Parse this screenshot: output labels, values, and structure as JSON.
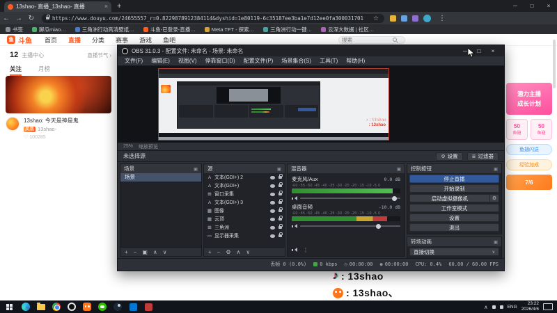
{
  "colors": {
    "douyu_orange": "#ff5d23",
    "obs_active_blue": "#31599b",
    "meter_green": "#3faa3f",
    "tiktok_cyan": "#25f4ee",
    "tiktok_red": "#fe2c55"
  },
  "icons": {
    "back": "←",
    "forward": "→",
    "refresh": "↻",
    "star": "☆",
    "more": "⋮",
    "min": "─",
    "max": "□",
    "close": "×",
    "newtab": "+",
    "plus": "+",
    "minus": "−",
    "up": "∧",
    "down": "∨",
    "gear": "⚙",
    "filter": "≣",
    "popout": "▣",
    "caret": "∨",
    "note": "♪",
    "clock": "◷",
    "rec": "●",
    "heart": "♡",
    "chev": "›",
    "tray_up": "∧"
  },
  "browser": {
    "tab_title": "13shao- 直播_13shao- 直播",
    "url": "https://www.douyu.com/24655557_r=0.8229878912384114&dyshid=1e80119-6c35187ee3ba1e7d12ee0fa300031701",
    "bookmarks": [
      "书签",
      "脚瓜miao…",
      "三角洲行动高清壁纸…",
      "斗鱼-已登录-直播…",
      "Meta TFT - 探索…",
      "三角洲行动一键…",
      "云深大数据 | 社区…"
    ]
  },
  "site": {
    "logo_glyph": "鱼",
    "logo_text": "斗鱼",
    "nav": [
      "首页",
      "直播",
      "分类",
      "赛事",
      "游戏",
      "鱼吧"
    ],
    "search_placeholder": "搜索",
    "sidebar": {
      "count": "12",
      "count_label": "主播中心",
      "more_link": "直播节气 ›",
      "tabs": [
        "关注",
        "月榜"
      ],
      "card": {
        "title": "13shao: 今天是神是鬼",
        "badge": "凤凰",
        "name": "13shao-",
        "viewers": "100285"
      }
    },
    "rail": {
      "banner_line1": "潜力主播",
      "banner_line2": "成长计划",
      "chip1_num": "50",
      "chip1_label": "鱼翅",
      "chip2_num": "50",
      "chip2_label": "鱼翅",
      "chip3": "鱼翅闪送",
      "chip4": "经验加成",
      "mini": "7/6"
    }
  },
  "overlay": {
    "line1": ": 13shao",
    "line2": ": 13shao、"
  },
  "obs": {
    "title": "OBS 31.0.3 - 配置文件: 未命名 - 场景: 未命名",
    "menus": [
      "文件(F)",
      "编辑(E)",
      "视图(V)",
      "停靠窗口(D)",
      "配置文件(P)",
      "场景集合(S)",
      "工具(T)",
      "帮助(H)"
    ],
    "preview": {
      "zoom": "25%",
      "zoom_hint": "缩放预览",
      "overlay1": "♪ : 13shao",
      "overlay2": ": 13shao"
    },
    "select_hint": "未选择源",
    "btn_settings": "设置",
    "btn_filters": "过滤器",
    "scenes": {
      "title": "场景",
      "items": [
        "场景"
      ]
    },
    "sources": {
      "title": "源",
      "items": [
        {
          "glyph": "A",
          "name": "文本(GDI+) 2"
        },
        {
          "glyph": "A",
          "name": "文本(GDI+)"
        },
        {
          "glyph": "⊞",
          "name": "窗口采集"
        },
        {
          "glyph": "A",
          "name": "文本(GDI+) 3"
        },
        {
          "glyph": "▦",
          "name": "图像"
        },
        {
          "glyph": "▦",
          "name": "云顶"
        },
        {
          "glyph": "⊞",
          "name": "三角洲"
        },
        {
          "glyph": "▭",
          "name": "显示器采集"
        }
      ]
    },
    "mixer": {
      "title": "混音器",
      "scale_text": "-60  -55  -50  -45  -40  -35  -30  -25  -20  -15  -10  -5   0",
      "channels": [
        {
          "name": "麦克风/Aux",
          "db": "0.0 dB"
        },
        {
          "name": "桌面音频",
          "db": "-10.0 dB"
        }
      ]
    },
    "controls": {
      "title": "控制按钮",
      "buttons": [
        "停止直播",
        "开始录制",
        "启动虚拟摄像机",
        "工作室模式",
        "设置",
        "退出"
      ]
    },
    "transitions": {
      "title": "转场动画",
      "value": "直接切换"
    },
    "status": {
      "dropped": "丢帧 0 (0.0%)",
      "bitrate": "0 kbps",
      "stream_time": "00:00:00",
      "rec_time": "00:00:00",
      "cpu": "CPU: 0.4%",
      "fps": "60.00 / 60.00 FPS"
    }
  },
  "taskbar": {
    "lang": "ENG",
    "time": "23:22",
    "date": "2026/4/6"
  }
}
